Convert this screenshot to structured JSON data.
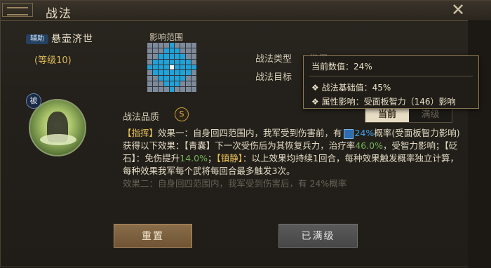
{
  "window": {
    "title": "战法",
    "close_label": "✕"
  },
  "skill": {
    "tag": "辅助",
    "name": "悬壶济世",
    "level": "(等级10)",
    "passive_badge": "被",
    "icon": "skill-portrait-icon"
  },
  "range": {
    "label": "影响范围",
    "grid": [
      [
        0,
        0,
        0,
        0,
        1,
        0,
        0,
        0,
        0
      ],
      [
        0,
        0,
        0,
        1,
        1,
        1,
        0,
        0,
        0
      ],
      [
        0,
        0,
        1,
        1,
        1,
        1,
        1,
        0,
        0
      ],
      [
        0,
        1,
        1,
        1,
        1,
        1,
        1,
        1,
        0
      ],
      [
        1,
        1,
        1,
        1,
        2,
        1,
        1,
        1,
        1
      ],
      [
        0,
        1,
        1,
        1,
        1,
        1,
        1,
        1,
        0
      ],
      [
        0,
        0,
        1,
        1,
        1,
        1,
        1,
        0,
        0
      ],
      [
        0,
        0,
        0,
        1,
        1,
        1,
        0,
        0,
        0
      ],
      [
        0,
        0,
        0,
        0,
        1,
        0,
        0,
        0,
        0
      ]
    ],
    "colors": {
      "empty": "#7f8a99",
      "area": "#1fa3d8",
      "center": "#ffffff"
    }
  },
  "info": {
    "type_label": "战法类型",
    "type_value": "指挥",
    "target_label": "战法目标"
  },
  "quality": {
    "label": "战法品质",
    "value": "S"
  },
  "toggle": {
    "current": "当前",
    "max": "满级"
  },
  "description": {
    "t1": "【指挥】",
    "t2": "效果一：自身回四范围内，我军受到伤害前，有",
    "t3": "24%",
    "t4": "概率(受面板智力影响)获得以下效果：【青囊】下一次受伤后为其恢复兵力，治疗率",
    "t5": "46.0%",
    "t6": "，受智力影响；【砭石】：免伤提升",
    "t7": "14.0%",
    "t8": "；",
    "t9": "【镇静】",
    "t10": "：以上效果均持续1回合，每种效果触发概率独立计算，每种效果我军每个武将每回合最多触发3次。",
    "faded": "效果二：自身回四范围内，我军受到伤害后，有 24%概率"
  },
  "buttons": {
    "reset": "重置",
    "maxed": "已满级"
  },
  "tooltip": {
    "current": "当前数值：24%",
    "base": "战法基础值：45%",
    "attr": "属性影响：受面板智力（146）影响"
  }
}
